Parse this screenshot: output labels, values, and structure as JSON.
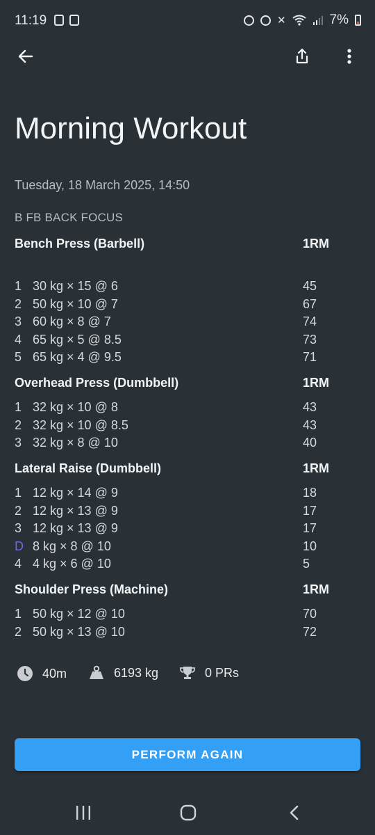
{
  "status_bar": {
    "time": "11:19",
    "battery": "7%"
  },
  "workout": {
    "title": "Morning Workout",
    "date": "Tuesday, 18 March 2025, 14:50",
    "routine": "B FB BACK FOCUS"
  },
  "exercises": [
    {
      "name": "Bench Press (Barbell)",
      "metric": "1RM",
      "sets": [
        {
          "idx": "1",
          "desc": "30 kg × 15 @ 6",
          "val": "45"
        },
        {
          "idx": "2",
          "desc": "50 kg × 10 @ 7",
          "val": "67"
        },
        {
          "idx": "3",
          "desc": "60 kg × 8 @ 7",
          "val": "74"
        },
        {
          "idx": "4",
          "desc": "65 kg × 5 @ 8.5",
          "val": "73"
        },
        {
          "idx": "5",
          "desc": "65 kg × 4 @ 9.5",
          "val": "71"
        }
      ]
    },
    {
      "name": "Overhead Press (Dumbbell)",
      "metric": "1RM",
      "sets": [
        {
          "idx": "1",
          "desc": "32 kg × 10 @ 8",
          "val": "43"
        },
        {
          "idx": "2",
          "desc": "32 kg × 10 @ 8.5",
          "val": "43"
        },
        {
          "idx": "3",
          "desc": "32 kg × 8 @ 10",
          "val": "40"
        }
      ]
    },
    {
      "name": "Lateral Raise (Dumbbell)",
      "metric": "1RM",
      "sets": [
        {
          "idx": "1",
          "desc": "12 kg × 14 @ 9",
          "val": "18"
        },
        {
          "idx": "2",
          "desc": "12 kg × 13 @ 9",
          "val": "17"
        },
        {
          "idx": "3",
          "desc": "12 kg × 13 @ 9",
          "val": "17"
        },
        {
          "idx": "D",
          "desc": "8 kg × 8 @ 10",
          "val": "10"
        },
        {
          "idx": "4",
          "desc": "4 kg × 6 @ 10",
          "val": "5"
        }
      ]
    },
    {
      "name": "Shoulder Press (Machine)",
      "metric": "1RM",
      "sets": [
        {
          "idx": "1",
          "desc": "50 kg × 12 @ 10",
          "val": "70"
        },
        {
          "idx": "2",
          "desc": "50 kg × 13 @ 10",
          "val": "72"
        }
      ]
    }
  ],
  "stats": {
    "duration": "40m",
    "volume": "6193 kg",
    "prs": "0 PRs"
  },
  "actions": {
    "perform_again": "PERFORM AGAIN"
  },
  "icons": {
    "back": "arrow-left-icon",
    "share": "share-icon",
    "more": "more-vert-icon",
    "clock": "clock-icon",
    "weight": "weight-icon",
    "trophy": "trophy-icon"
  },
  "colors": {
    "background": "#293036",
    "accent": "#33a0f5",
    "drop_set": "#7a62e8"
  }
}
